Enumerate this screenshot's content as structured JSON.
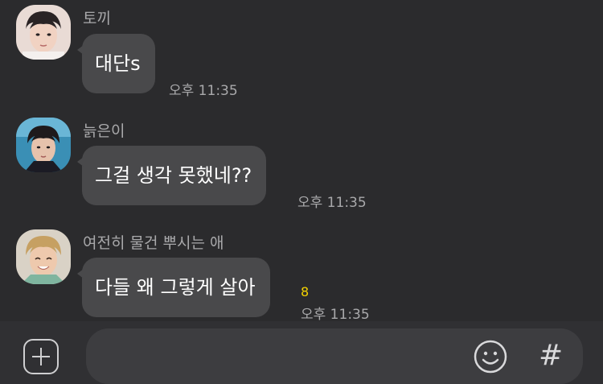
{
  "messages": [
    {
      "sender": "토끼",
      "text": "대단s",
      "time": "오후 11:35",
      "unread": ""
    },
    {
      "sender": "늙은이",
      "text": "그걸 생각 못했네??",
      "time": "오후 11:35",
      "unread": ""
    },
    {
      "sender": "여전히 물건 뿌시는 애",
      "text": "다들 왜 그렇게 살아",
      "time": "오후 11:35",
      "unread": "8"
    }
  ],
  "composer": {
    "input_value": "",
    "emoji_icon": "smiley-icon",
    "plus_icon": "plus-icon",
    "hash_icon": "hash-icon",
    "hash_label": "#"
  },
  "colors": {
    "background": "#2b2b2d",
    "bubble": "#49494b",
    "unread": "#f3d200"
  }
}
